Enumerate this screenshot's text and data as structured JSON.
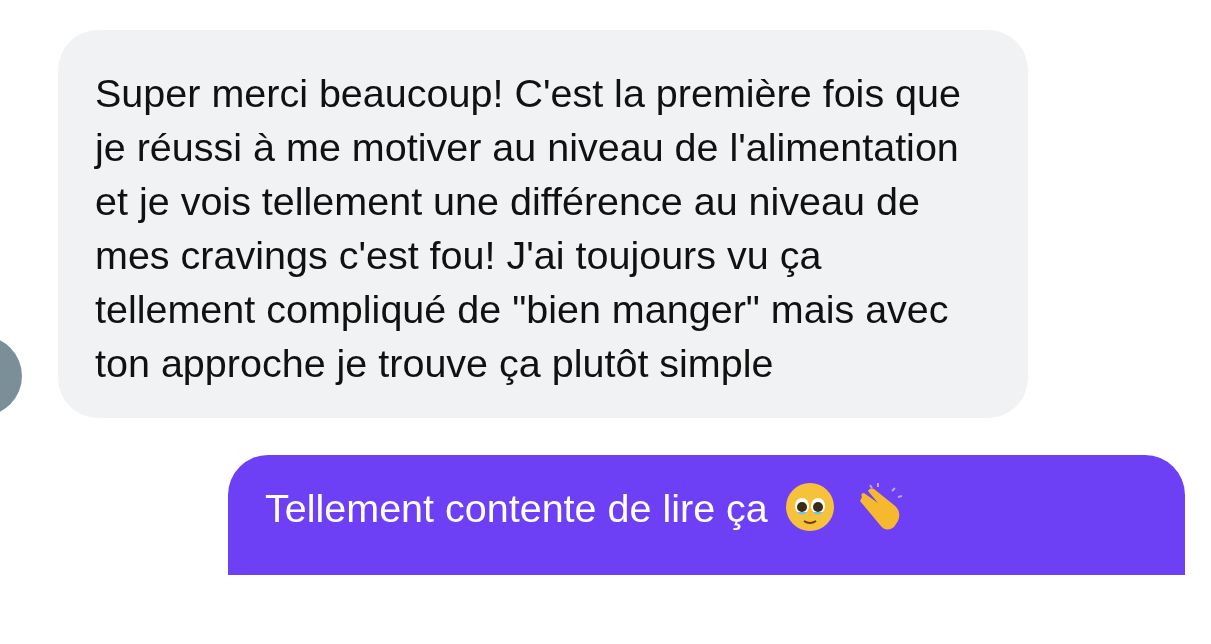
{
  "messages": [
    {
      "kind": "incoming",
      "text": "Super merci beaucoup! C'est la première fois que je réussi à me motiver au niveau de l'alimentation et je vois tellement une différence au niveau de mes cravings c'est fou! J'ai toujours vu ça tellement compliqué de \"bien manger\" mais avec ton approche je trouve ça plutôt simple"
    },
    {
      "kind": "outgoing",
      "text": "Tellement contente de lire ça"
    }
  ]
}
